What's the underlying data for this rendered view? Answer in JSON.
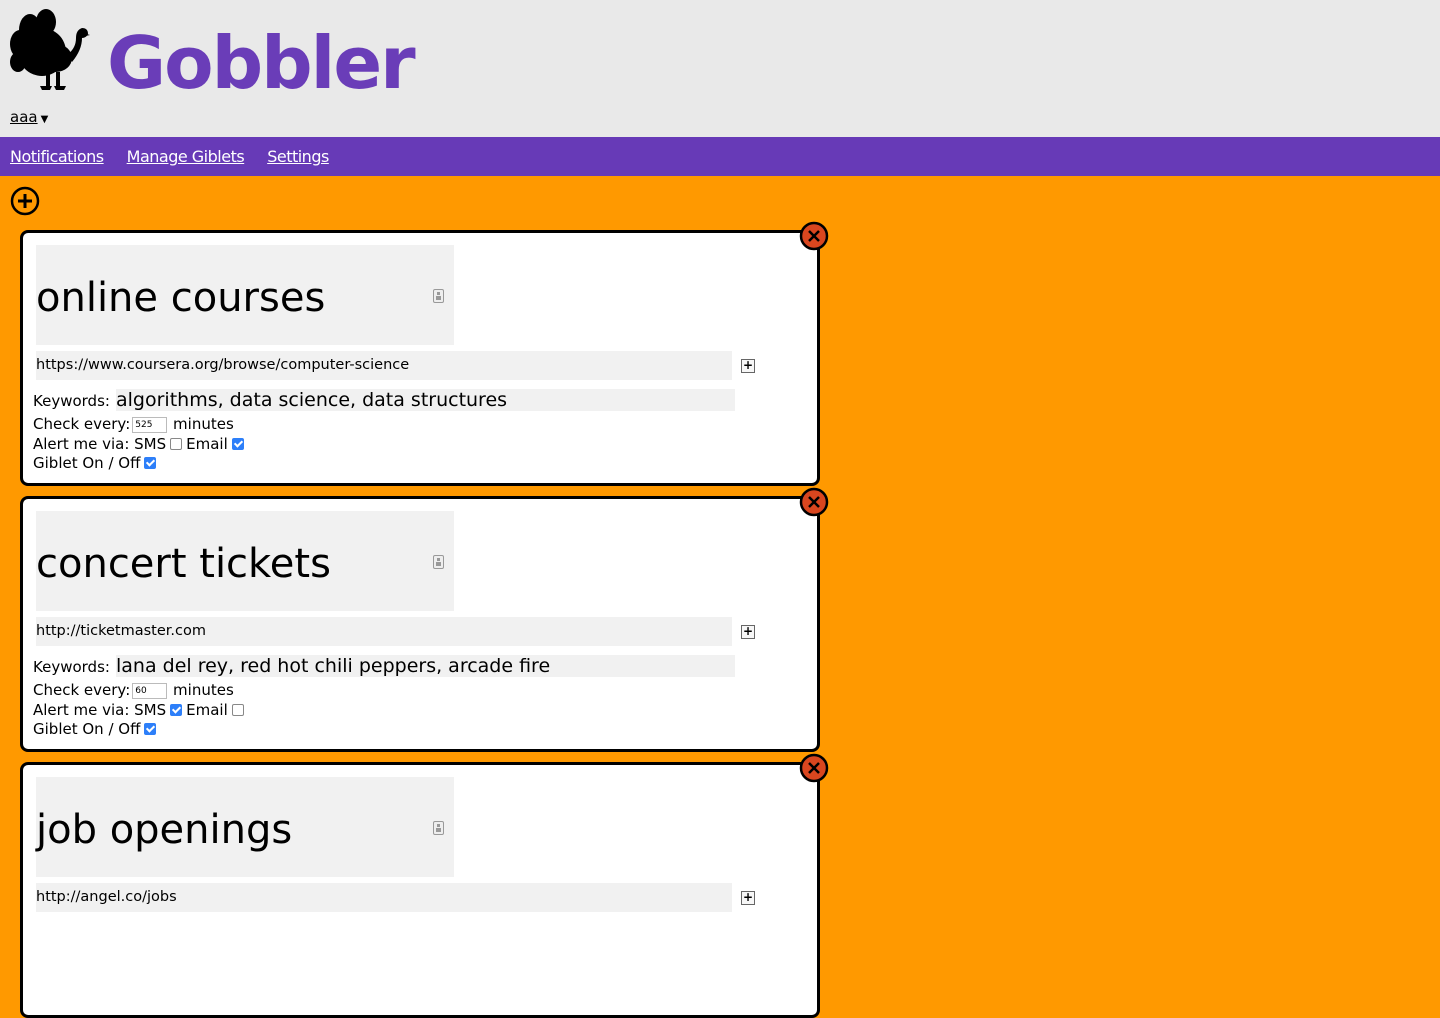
{
  "app": {
    "brand": "Gobbler",
    "user": "aaa",
    "logo_icon": "turkey-icon"
  },
  "nav": {
    "items": [
      {
        "label": "Notifications"
      },
      {
        "label": "Manage Giblets"
      },
      {
        "label": "Settings"
      }
    ]
  },
  "labels": {
    "keywords": "Keywords:",
    "check_every": "Check every:",
    "minutes": "minutes",
    "alert_via": "Alert me via: SMS",
    "email": "Email",
    "giblet_toggle": "Giblet On / Off"
  },
  "colors": {
    "background": "#ff9900",
    "nav": "#673ab7",
    "brand": "#6a3db8",
    "close_button": "#d9461f"
  },
  "giblets": [
    {
      "title": "online courses",
      "url": "https://www.coursera.org/browse/computer-science",
      "keywords": "algorithms, data science, data structures",
      "check_every": "525",
      "sms": false,
      "email": true,
      "enabled": true
    },
    {
      "title": "concert tickets",
      "url": "http://ticketmaster.com",
      "keywords": "lana del rey, red hot chili peppers, arcade fire",
      "check_every": "60",
      "sms": true,
      "email": false,
      "enabled": true
    },
    {
      "title": "job openings",
      "url": "http://angel.co/jobs",
      "keywords": "",
      "check_every": "",
      "sms": false,
      "email": false,
      "enabled": false
    }
  ]
}
